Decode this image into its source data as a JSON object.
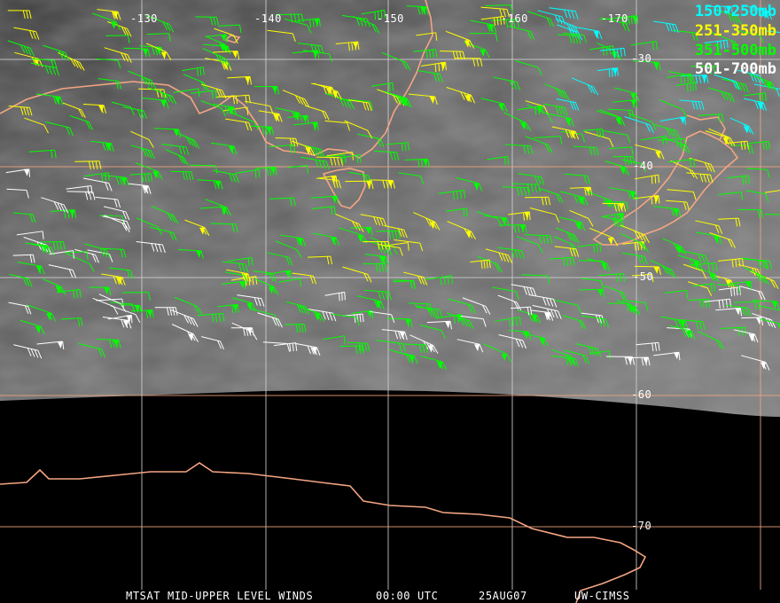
{
  "title": "MTSAT MID-UPPER LEVEL WINDS",
  "time": "00:00 UTC",
  "date": "25AUG07",
  "credit": "UW-CIMSS",
  "legend": [
    {
      "label": "150-250mb",
      "color": "#00ffff"
    },
    {
      "label": "251-350mb",
      "color": "#ffff00"
    },
    {
      "label": "351-500mb",
      "color": "#00ff00"
    },
    {
      "label": "501-700mb",
      "color": "#ffffff"
    }
  ],
  "longitude_labels": [
    "-130",
    "-140",
    "-150",
    "-160",
    "-170"
  ],
  "latitude_labels": [
    "-30",
    "-40",
    "-50",
    "-60",
    "-70"
  ],
  "colors": {
    "coastline": "#f4a582",
    "grid_orange": "#f4a582",
    "grid_white": "#d0d0d0"
  }
}
